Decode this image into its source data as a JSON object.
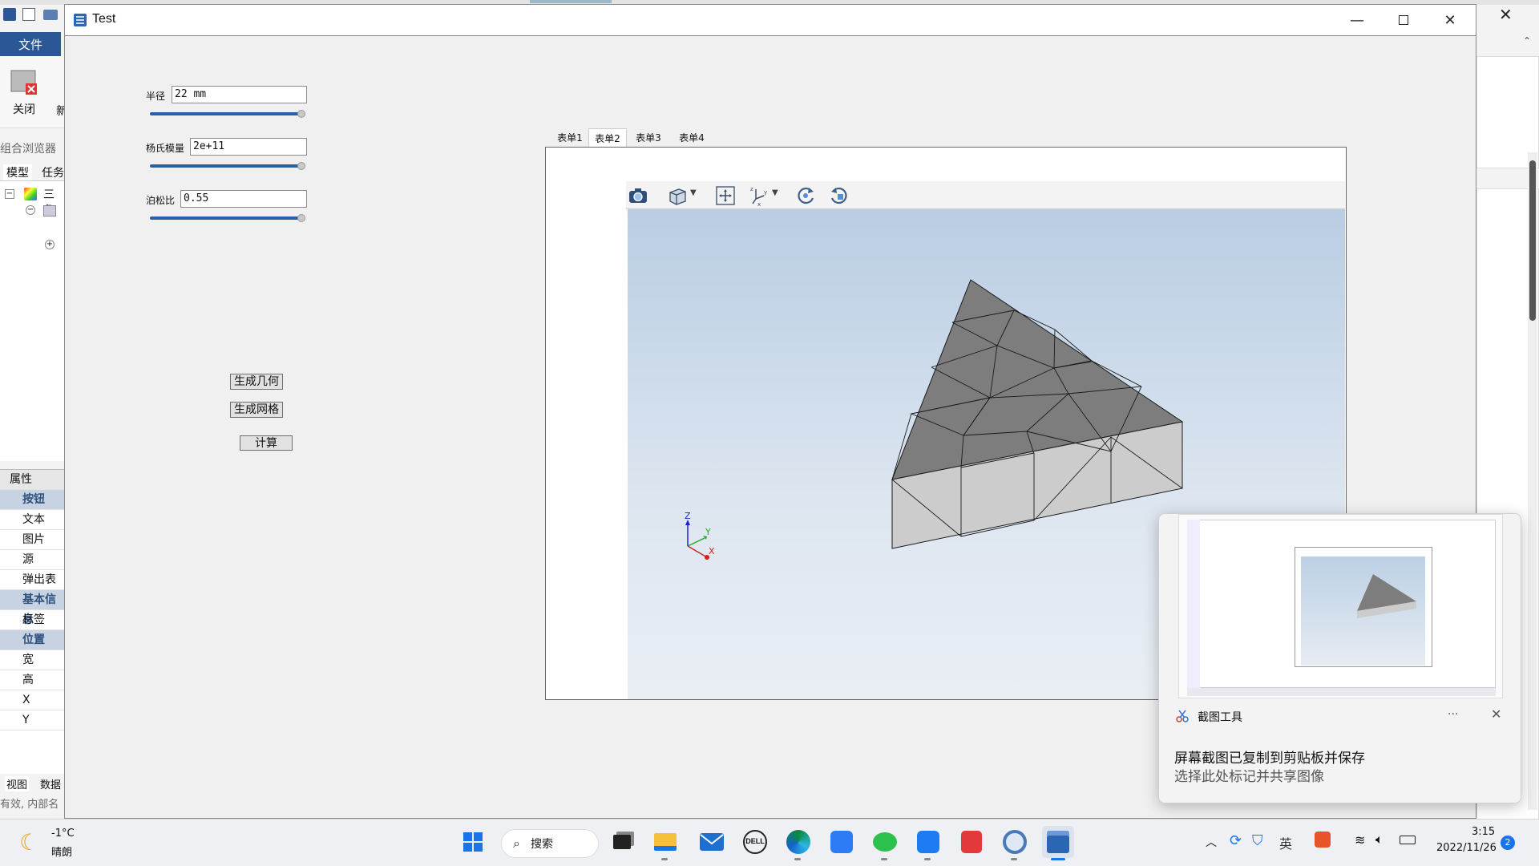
{
  "window": {
    "title": "Test"
  },
  "background_app": {
    "file_menu": "文件",
    "close_tool": "关闭",
    "new_tool_partial": "新",
    "combo_browser": "组合浏览器",
    "tabs": [
      "模型",
      "任务"
    ],
    "tree_root": "三角",
    "properties_header": "属性",
    "properties": [
      {
        "label": "按钮",
        "category": true
      },
      {
        "label": "文本",
        "category": false
      },
      {
        "label": "图片",
        "category": false
      },
      {
        "label": "源",
        "category": false
      },
      {
        "label": "弹出表单",
        "category": false
      },
      {
        "label": "基本信息",
        "category": true
      },
      {
        "label": "标签",
        "category": false
      },
      {
        "label": "位置",
        "category": true
      },
      {
        "label": "宽",
        "category": false
      },
      {
        "label": "高",
        "category": false
      },
      {
        "label": "X",
        "category": false
      },
      {
        "label": "Y",
        "category": false
      }
    ],
    "bottom_tabs": [
      "视图",
      "数据"
    ],
    "status": "有效, 内部名"
  },
  "form": {
    "radius": {
      "label": "半径",
      "value": "22 mm",
      "slider_fraction": 1.0
    },
    "youngs": {
      "label": "杨氏模量",
      "value": "2e+11",
      "slider_fraction": 1.0
    },
    "poisson": {
      "label": "泊松比",
      "value": "0.55",
      "slider_fraction": 1.0
    },
    "gen_geometry_button": "生成几何",
    "gen_mesh_button": "生成网格",
    "compute_button": "计算"
  },
  "tabs": [
    {
      "label": "表单1",
      "active": false
    },
    {
      "label": "表单2",
      "active": true
    },
    {
      "label": "表单3",
      "active": false
    },
    {
      "label": "表单4",
      "active": false
    }
  ],
  "viewer": {
    "toolbar": [
      "camera-icon",
      "view-cube-icon",
      "fit-all-icon",
      "axis-view-icon",
      "rotate-left-icon",
      "rotate-right-icon"
    ],
    "axis_labels": {
      "x": "X",
      "y": "Y",
      "z": "Z"
    }
  },
  "notification": {
    "app_name": "截图工具",
    "more": "···",
    "message_line1": "屏幕截图已复制到剪贴板并保存",
    "message_line2": "选择此处标记并共享图像"
  },
  "taskbar": {
    "weather_temp": "-1°C",
    "weather_desc": "晴朗",
    "search_label": "搜索",
    "time": "3:15",
    "date": "2022/11/26",
    "notification_count": "2"
  },
  "colors": {
    "accent": "#2a5fa8",
    "file_menu": "#2b5797",
    "mesh_top": "#7d7d7d",
    "mesh_side": "#cccccc"
  }
}
